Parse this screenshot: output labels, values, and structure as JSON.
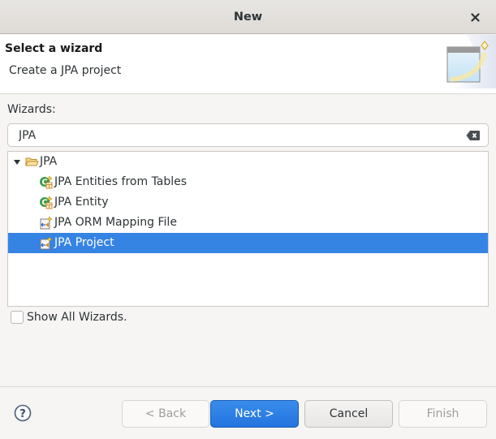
{
  "window": {
    "title": "New",
    "close_icon": "close-icon"
  },
  "banner": {
    "heading": "Select a wizard",
    "description": "Create a JPA project",
    "image": "new-wizard-banner-image"
  },
  "wizards": {
    "label": "Wizards:",
    "filter_value": "JPA",
    "clear_icon": "clear-text-icon",
    "tree": [
      {
        "label": "JPA",
        "icon": "folder-open-icon",
        "expanded": true,
        "level": 0,
        "selected": false
      },
      {
        "label": "JPA Entities from Tables",
        "icon": "jpa-entity-icon",
        "level": 1,
        "selected": false
      },
      {
        "label": "JPA Entity",
        "icon": "jpa-entity-icon",
        "level": 1,
        "selected": false
      },
      {
        "label": "JPA ORM Mapping File",
        "icon": "orm-mapping-file-icon",
        "level": 1,
        "selected": false
      },
      {
        "label": "JPA Project",
        "icon": "jpa-project-icon",
        "level": 1,
        "selected": true
      }
    ],
    "show_all_label": "Show All Wizards.",
    "show_all_checked": false
  },
  "footer": {
    "help_icon": "help-icon",
    "back_label": "< Back",
    "next_label": "Next >",
    "cancel_label": "Cancel",
    "finish_label": "Finish",
    "back_enabled": false,
    "next_enabled": true,
    "cancel_enabled": true,
    "finish_enabled": false
  },
  "colors": {
    "selection": "#3584e4",
    "primary_button": "#2a7de1",
    "disabled_text": "#a19d99"
  }
}
